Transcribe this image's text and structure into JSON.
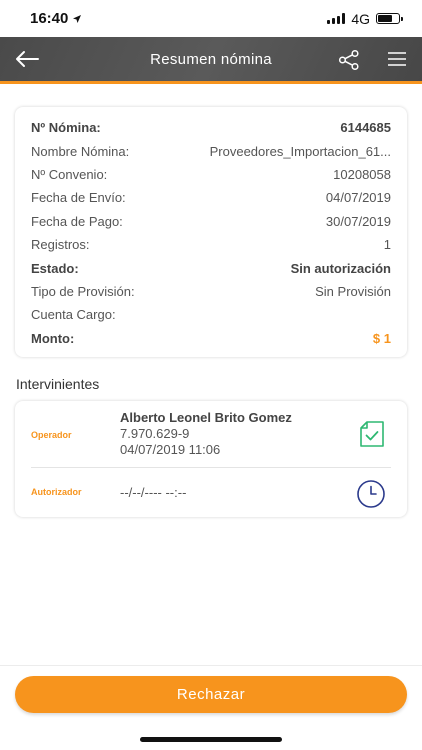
{
  "status": {
    "time": "16:40",
    "network": "4G"
  },
  "header": {
    "title": "Resumen nómina"
  },
  "summary": {
    "rows": [
      {
        "label": "Nº Nómina:",
        "value": "6144685"
      },
      {
        "label": "Nombre Nómina:",
        "value": "Proveedores_Importacion_61..."
      },
      {
        "label": "Nº Convenio:",
        "value": "10208058"
      },
      {
        "label": "Fecha de Envío:",
        "value": "04/07/2019"
      },
      {
        "label": "Fecha de Pago:",
        "value": "30/07/2019"
      },
      {
        "label": "Registros:",
        "value": "1"
      },
      {
        "label": "Estado:",
        "value": "Sin autorización"
      },
      {
        "label": "Tipo de Provisión:",
        "value": "Sin Provisión"
      },
      {
        "label": "Cuenta Cargo:",
        "value": ""
      },
      {
        "label": "Monto:",
        "value": "$ 1"
      }
    ]
  },
  "intervinientes": {
    "title": "Intervinientes",
    "operator": {
      "role": "Operador",
      "name": "Alberto Leonel Brito Gomez",
      "rut": "7.970.629-9",
      "datetime": "04/07/2019 11:06",
      "icon": "document-check-icon"
    },
    "authorizer": {
      "role": "Autorizador",
      "datetime": "--/--/---- --:--",
      "icon": "clock-icon"
    }
  },
  "actions": {
    "reject_label": "Rechazar"
  },
  "colors": {
    "accent": "#f7941d",
    "header": "#4f4f4f",
    "success": "#2eb872",
    "pending": "#2b3a8c"
  }
}
